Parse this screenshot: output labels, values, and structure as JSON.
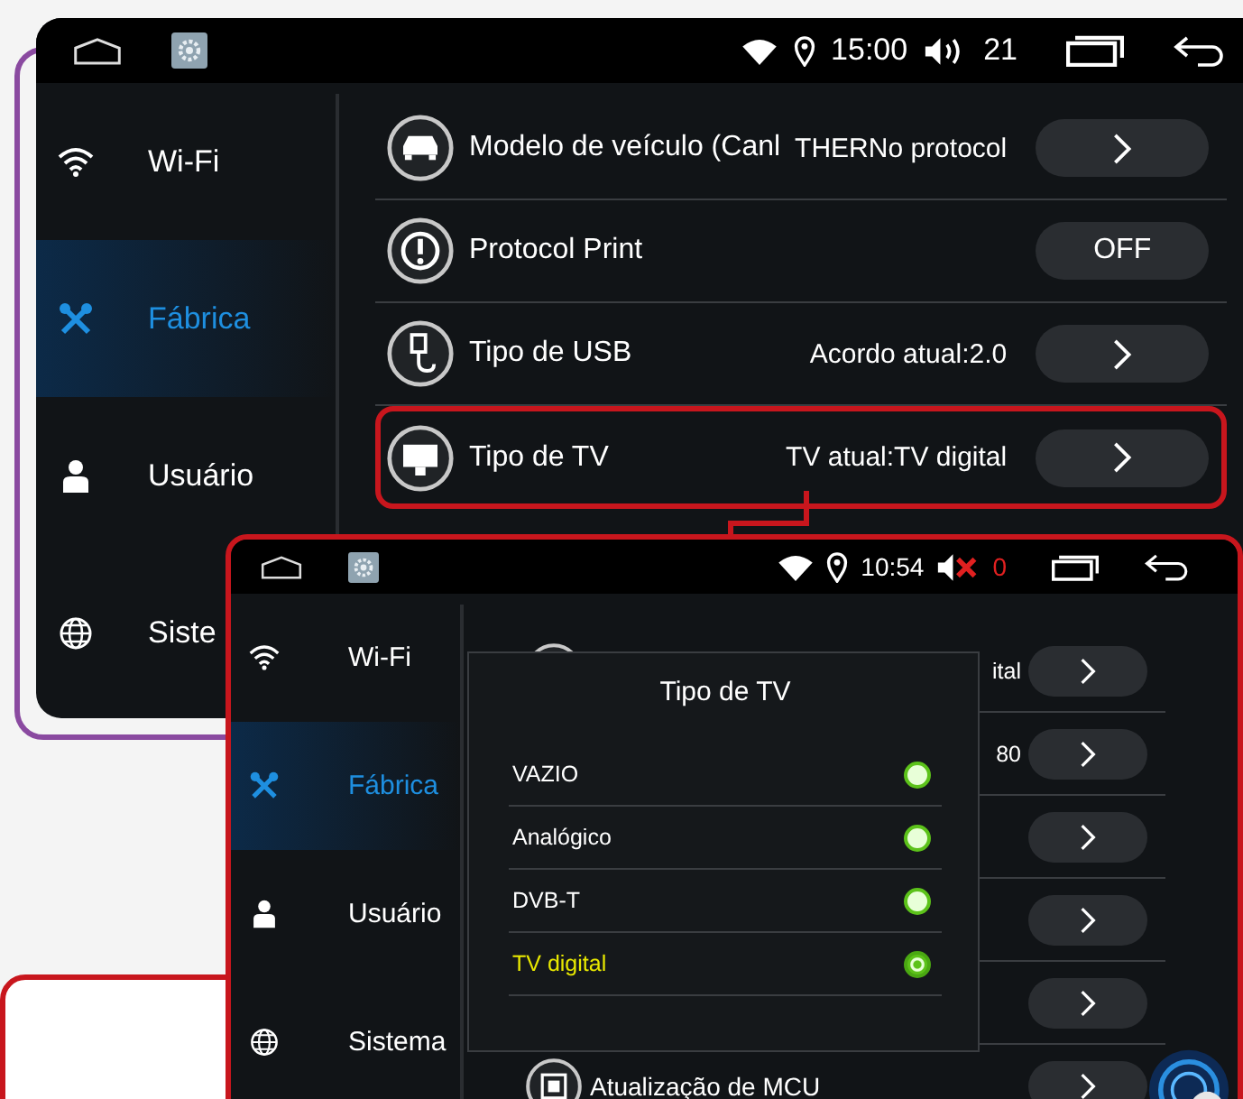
{
  "main_screen": {
    "status_bar": {
      "time": "15:00",
      "volume": "21",
      "muted": false
    },
    "sidebar": {
      "items": [
        {
          "label": "Wi-Fi",
          "selected": false
        },
        {
          "label": "Fábrica",
          "selected": true
        },
        {
          "label": "Usuário",
          "selected": false
        },
        {
          "label": "Siste",
          "selected": false
        }
      ]
    },
    "rows": [
      {
        "label": "Modelo de veículo (Canl",
        "value": "THERNo protocol",
        "kind": "arrow",
        "highlighted": false
      },
      {
        "label": "Protocol Print",
        "kind": "toggle",
        "control": "OFF",
        "highlighted": false
      },
      {
        "label": "Tipo de USB",
        "value": "Acordo atual:2.0",
        "kind": "arrow",
        "highlighted": false
      },
      {
        "label": "Tipo de TV",
        "value": "TV atual:TV digital",
        "kind": "arrow",
        "highlighted": true
      }
    ]
  },
  "zoomed_screen": {
    "status_bar": {
      "time": "10:54",
      "volume": "0",
      "muted": true
    },
    "sidebar": {
      "items": [
        {
          "label": "Wi-Fi",
          "selected": false
        },
        {
          "label": "Fábrica",
          "selected": true
        },
        {
          "label": "Usuário",
          "selected": false
        },
        {
          "label": "Sistema",
          "selected": false
        }
      ]
    },
    "rows": [
      {
        "value": "ital",
        "kind": "arrow"
      },
      {
        "value": "80",
        "kind": "arrow"
      },
      {
        "kind": "arrow"
      },
      {
        "kind": "arrow"
      },
      {
        "kind": "arrow"
      },
      {
        "label": "Atualização de MCU",
        "kind": "arrow"
      }
    ],
    "dialog": {
      "title": "Tipo de TV",
      "options": [
        {
          "label": "VAZIO",
          "selected": false
        },
        {
          "label": "Analógico",
          "selected": false
        },
        {
          "label": "DVB-T",
          "selected": false
        },
        {
          "label": "TV digital",
          "selected": true
        }
      ]
    }
  }
}
